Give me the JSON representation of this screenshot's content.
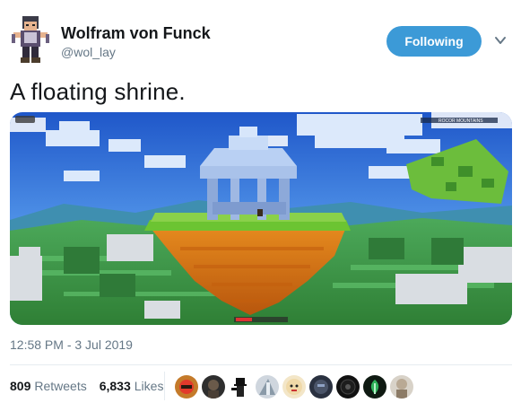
{
  "tweet": {
    "author_name": "Wolfram von Funck",
    "author_handle": "@wol_lay",
    "follow_label": "Following",
    "text": "A floating shrine.",
    "timestamp": "12:58 PM - 3 Jul 2019",
    "minimap_label": "ROCOR MOUNTAINS"
  },
  "stats": {
    "retweets_count": "809",
    "retweets_label": "Retweets",
    "likes_count": "6,833",
    "likes_label": "Likes"
  },
  "likers": [
    "avatar-1",
    "avatar-2",
    "avatar-3",
    "avatar-4",
    "avatar-5",
    "avatar-6",
    "avatar-7",
    "avatar-8",
    "avatar-9"
  ],
  "colors": {
    "follow_button": "#3c9ad7",
    "primary_text": "#14171a",
    "secondary_text": "#657786",
    "divider": "#e6ecf0"
  }
}
